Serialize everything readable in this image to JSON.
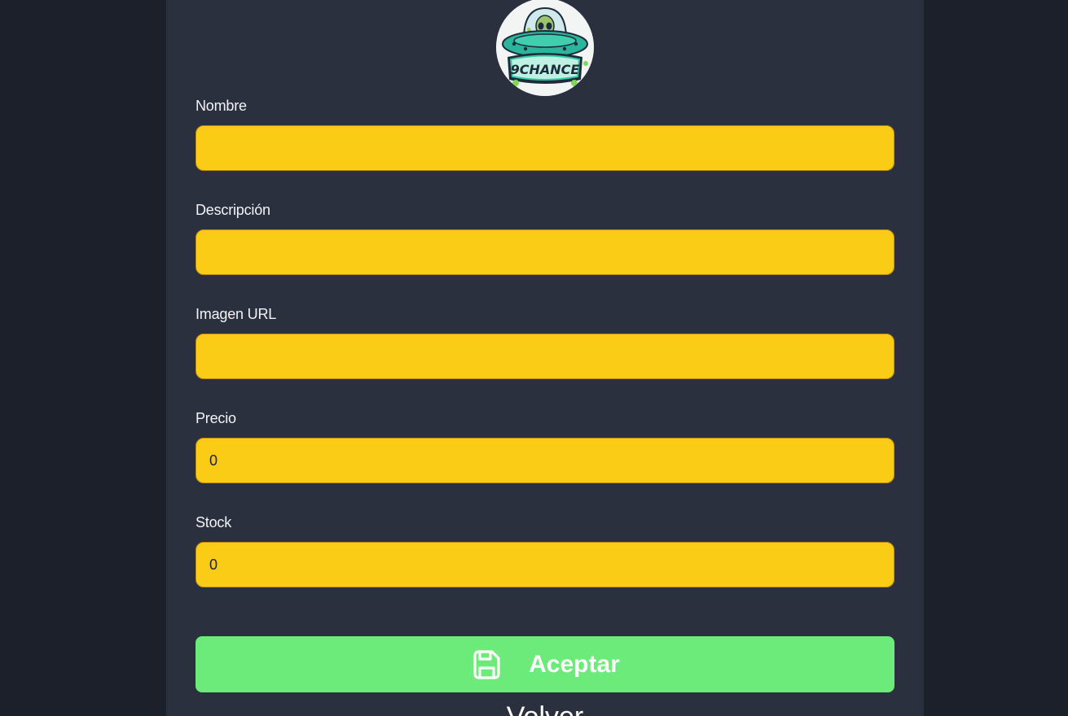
{
  "logo": {
    "icon": "alien-ufo-logo-icon",
    "text": "9CHANCE"
  },
  "form": {
    "fields": [
      {
        "label": "Nombre",
        "value": "",
        "type": "text"
      },
      {
        "label": "Descripción",
        "value": "",
        "type": "text"
      },
      {
        "label": "Imagen URL",
        "value": "",
        "type": "text"
      },
      {
        "label": "Precio",
        "value": "0",
        "type": "number"
      },
      {
        "label": "Stock",
        "value": "0",
        "type": "number"
      }
    ]
  },
  "actions": {
    "accept_label": "Aceptar",
    "accept_icon": "save-icon",
    "back_label": "Volver"
  },
  "colors": {
    "page_bg": "#1b202b",
    "panel_bg": "#2b303e",
    "input_bg": "#facc15",
    "accept_bg": "#6ceb7b",
    "text": "#f1f3f7"
  }
}
